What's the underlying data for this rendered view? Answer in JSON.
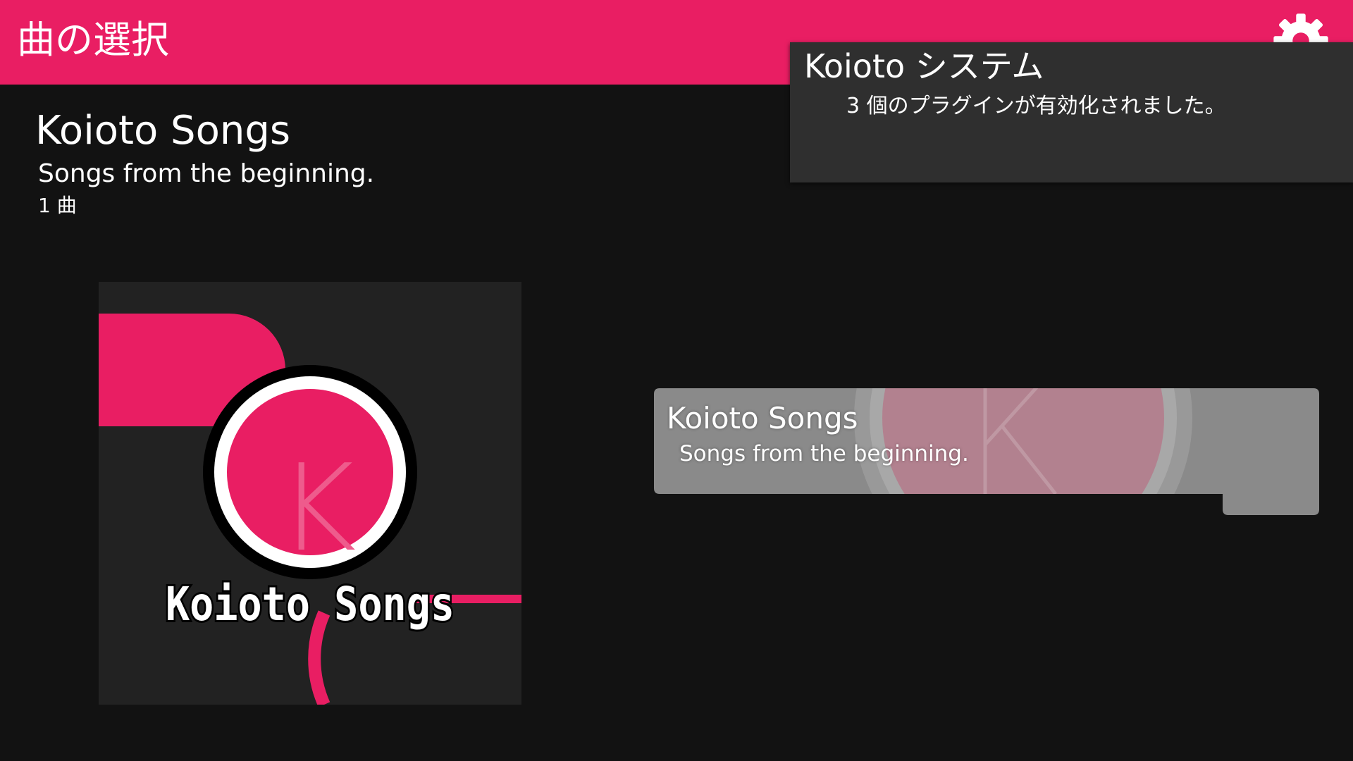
{
  "header": {
    "title": "曲の選択",
    "settings_icon": "gear-icon"
  },
  "folder": {
    "title": "Koioto Songs",
    "description": "Songs from the beginning.",
    "count": "1 曲"
  },
  "cover_art": {
    "letter": "K",
    "label": "Koioto Songs"
  },
  "song_list": {
    "items": [
      {
        "title": "Koioto Songs",
        "description": "Songs from the beginning.",
        "selected": true
      }
    ]
  },
  "notification": {
    "title": "Koioto システム",
    "message": "3 個のプラグインが有効化されました。"
  },
  "colors": {
    "accent": "#e91e63",
    "background": "#121212",
    "panel": "#2f2f2f",
    "cover_background": "#222222",
    "song_item": "#8a8a8a"
  }
}
